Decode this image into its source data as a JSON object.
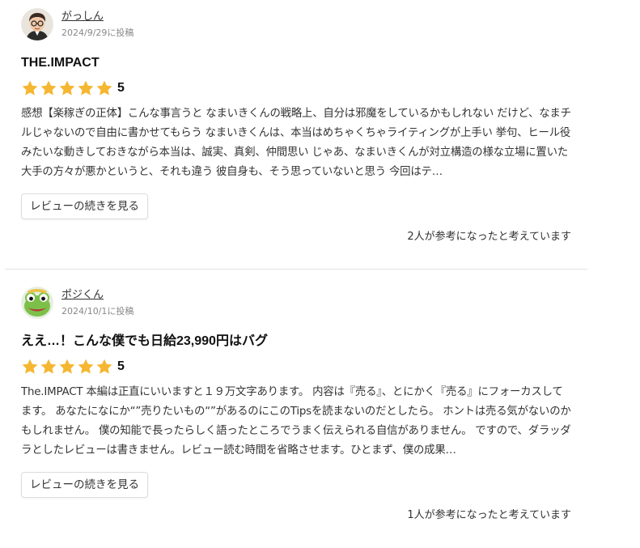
{
  "colors": {
    "star": "#f5b731",
    "text": "#333333",
    "muted": "#888888",
    "divider": "#e3e3e3"
  },
  "reviews": [
    {
      "author": "がっしん",
      "date": "2024/9/29に投稿",
      "avatar_icon": "avatar-man-with-glasses-icon",
      "title": "THE.IMPACT",
      "rating": 5,
      "rating_label": "5",
      "body": "感想【楽稼ぎの正体】こんな事言うと なまいきくんの戦略上、自分は邪魔をしているかもしれない だけど、なまチルじゃないので自由に書かせてもらう なまいきくんは、本当はめちゃくちゃライティングが上手い 挙句、ヒール役みたいな動きしておきながら本当は、誠実、真剣、仲間思い じゃあ、なまいきくんが対立構造の様な立場に置いた大手の方々が悪かというと、それも違う 彼自身も、そう思っていないと思う 今回はテ…",
      "more_label": "レビューの続きを見る",
      "helpful": "2人が参考になったと考えています"
    },
    {
      "author": "ポジくん",
      "date": "2024/10/1に投稿",
      "avatar_icon": "avatar-frog-icon",
      "title": "ええ…！こんな僕でも日給23,990円はバグ",
      "rating": 5,
      "rating_label": "5",
      "body": "The.IMPACT 本編は正直にいいますと１９万文字あります。 内容は『売る』、とにかく『売る』にフォーカスしてます。 あなたになにか“”売りたいもの“”があるのにこのTipsを読まないのだとしたら。 ホントは売る気がないのかもしれません。 僕の知能で長ったらしく語ったところでうまく伝えられる自信がありません。 ですので、ダラッダラとしたレビューは書きません。レビュー読む時間を省略させます。ひとまず、僕の成果…",
      "more_label": "レビューの続きを見る",
      "helpful": "1人が参考になったと考えています"
    }
  ]
}
